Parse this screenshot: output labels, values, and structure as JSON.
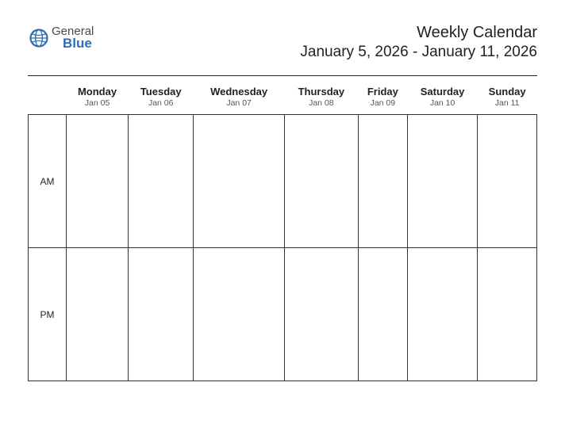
{
  "logo": {
    "line1": "General",
    "line2": "Blue"
  },
  "header": {
    "title": "Weekly Calendar",
    "date_range": "January 5, 2026 - January 11, 2026"
  },
  "days": [
    {
      "name": "Monday",
      "date": "Jan 05"
    },
    {
      "name": "Tuesday",
      "date": "Jan 06"
    },
    {
      "name": "Wednesday",
      "date": "Jan 07"
    },
    {
      "name": "Thursday",
      "date": "Jan 08"
    },
    {
      "name": "Friday",
      "date": "Jan 09"
    },
    {
      "name": "Saturday",
      "date": "Jan 10"
    },
    {
      "name": "Sunday",
      "date": "Jan 11"
    }
  ],
  "rows": {
    "am": "AM",
    "pm": "PM"
  }
}
